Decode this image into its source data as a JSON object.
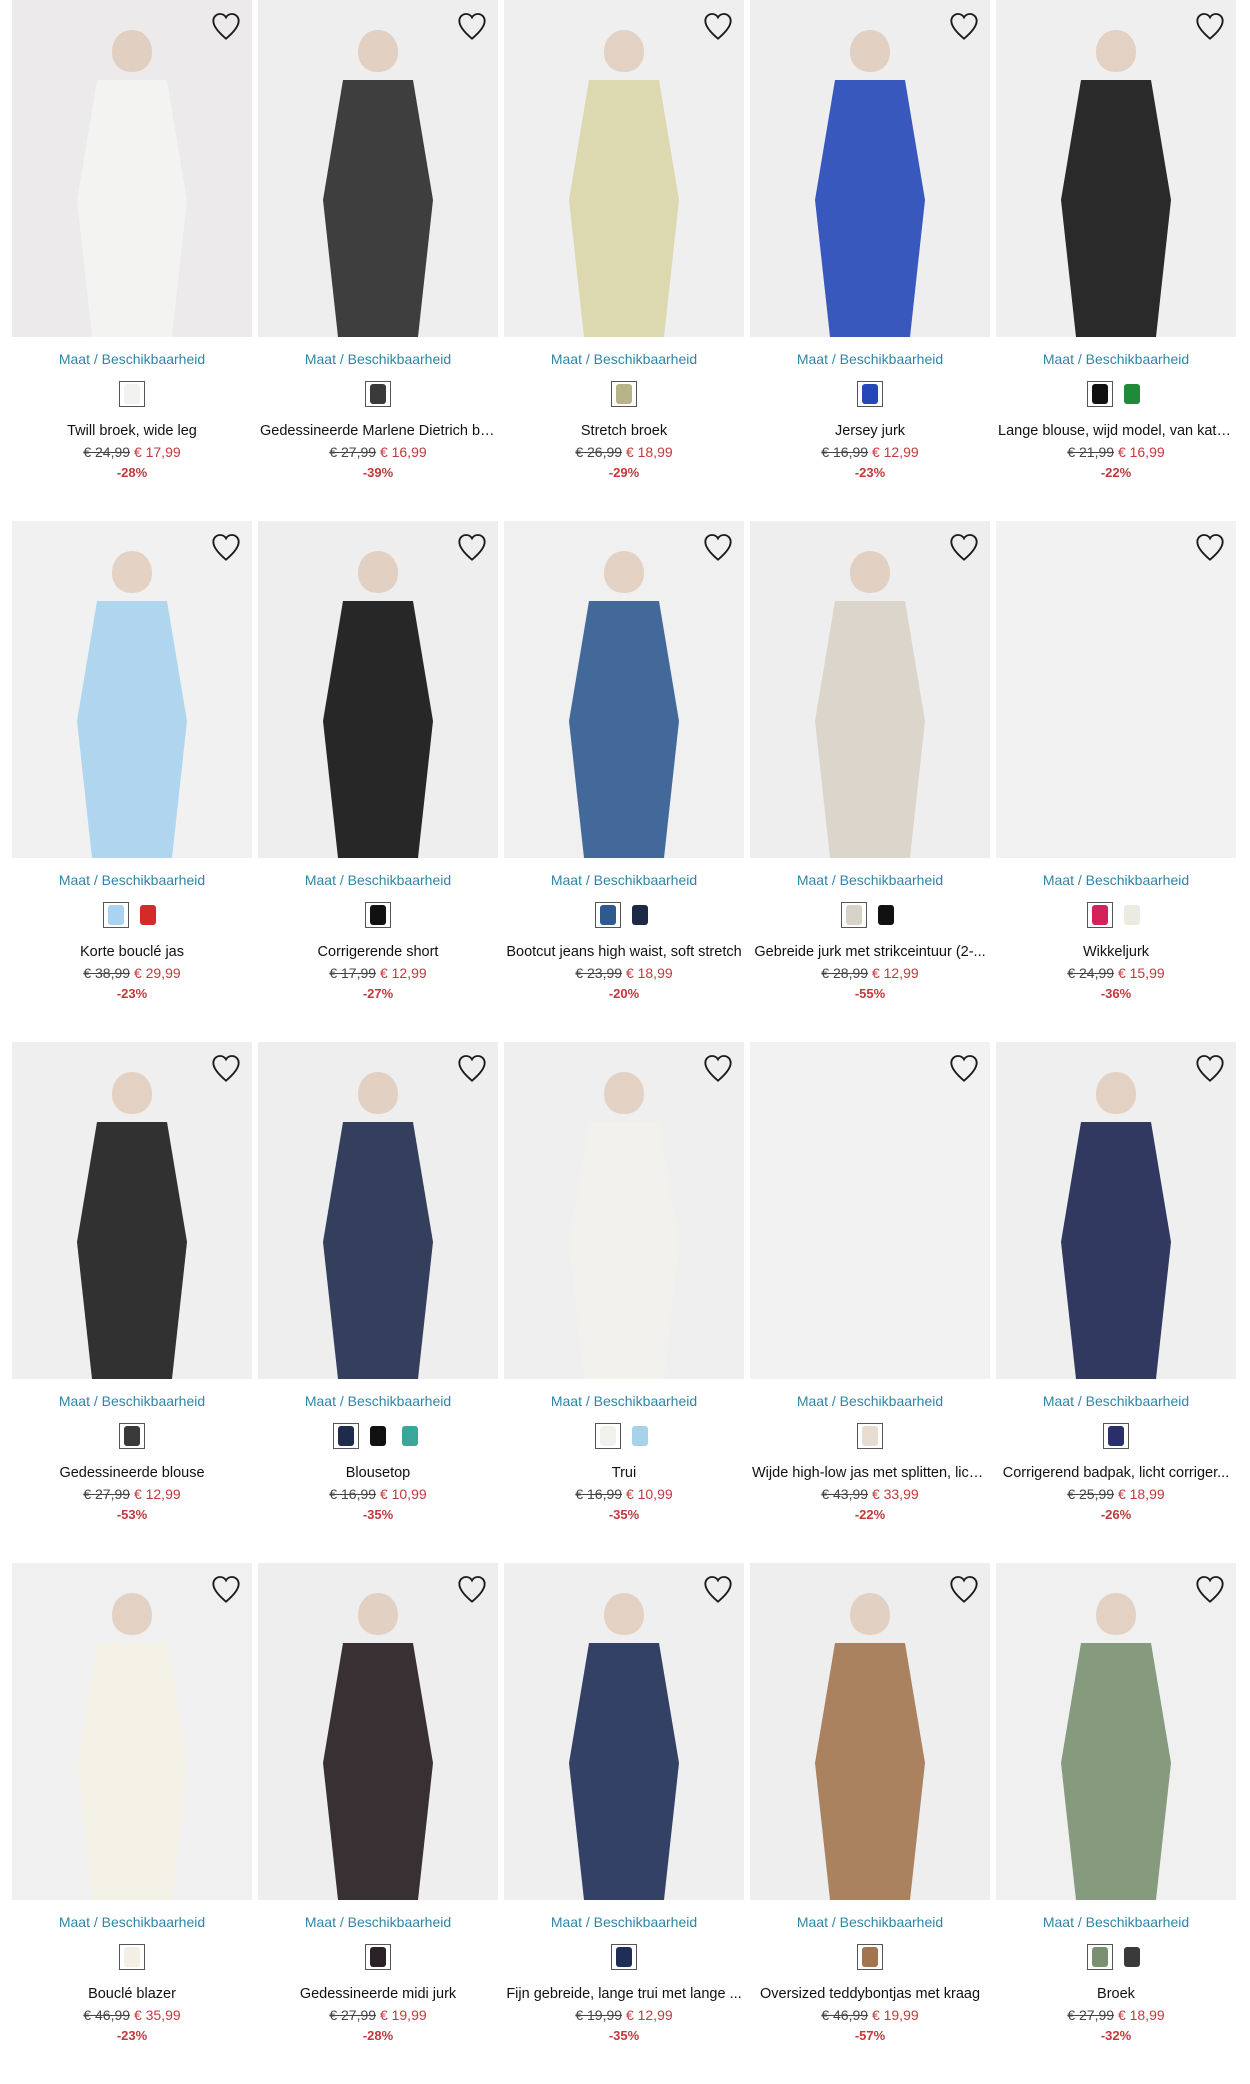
{
  "size_link_label": "Maat / Beschikbaarheid",
  "colors": {
    "link": "#2f85a6",
    "sale": "#c2393c"
  },
  "products": [
    {
      "name": "Twill broek, wide leg",
      "old_price": "€ 24,99",
      "new_price": "€ 17,99",
      "discount": "-28%",
      "image_bg": "#eceaea",
      "garment": "#f4f4f2",
      "swatches": [
        "#f2f2f0"
      ]
    },
    {
      "name": "Gedessineerde Marlene Dietrich br...",
      "old_price": "€ 27,99",
      "new_price": "€ 16,99",
      "discount": "-39%",
      "image_bg": "#eeeeee",
      "garment": "#2a2a2a",
      "swatches": [
        "#3a3a3a"
      ]
    },
    {
      "name": "Stretch broek",
      "old_price": "€ 26,99",
      "new_price": "€ 18,99",
      "discount": "-29%",
      "image_bg": "#efefef",
      "garment": "#d9d6a8",
      "swatches": [
        "#b9b38a"
      ]
    },
    {
      "name": "Jersey jurk",
      "old_price": "€ 16,99",
      "new_price": "€ 12,99",
      "discount": "-23%",
      "image_bg": "#eeeeee",
      "garment": "#2547b8",
      "swatches": [
        "#2547b8"
      ]
    },
    {
      "name": "Lange blouse, wijd model, van katoen",
      "old_price": "€ 21,99",
      "new_price": "€ 16,99",
      "discount": "-22%",
      "image_bg": "#efefef",
      "garment": "#141414",
      "swatches": [
        "#111111",
        "#1e8a3a"
      ]
    },
    {
      "name": "Korte bouclé jas",
      "old_price": "€ 38,99",
      "new_price": "€ 29,99",
      "discount": "-23%",
      "image_bg": "#f1f1f1",
      "garment": "#a9d3ee",
      "swatches": [
        "#a9d3ee",
        "#d42a2a"
      ]
    },
    {
      "name": "Corrigerende short",
      "old_price": "€ 17,99",
      "new_price": "€ 12,99",
      "discount": "-27%",
      "image_bg": "#eeeeee",
      "garment": "#111111",
      "swatches": [
        "#111111"
      ]
    },
    {
      "name": "Bootcut jeans high waist, soft stretch",
      "old_price": "€ 23,99",
      "new_price": "€ 18,99",
      "discount": "-20%",
      "image_bg": "#f0f0f0",
      "garment": "#2f5a8f",
      "swatches": [
        "#2f5a8f",
        "#1c2a45"
      ]
    },
    {
      "name": "Gebreide jurk met strikceintuur (2-...",
      "old_price": "€ 28,99",
      "new_price": "€ 12,99",
      "discount": "-55%",
      "image_bg": "#eeeeee",
      "garment": "#d8d2c8",
      "swatches": [
        "#d8d2c8",
        "#111111"
      ]
    },
    {
      "name": "Wikkeljurk",
      "old_price": "€ 24,99",
      "new_price": "€ 15,99",
      "discount": "-36%",
      "image_bg": "#f2f2f2",
      "garment": "#f2f2f2",
      "swatches": [
        "#d4215a",
        "#ecebe2"
      ]
    },
    {
      "name": "Gedessineerde blouse",
      "old_price": "€ 27,99",
      "new_price": "€ 12,99",
      "discount": "-53%",
      "image_bg": "#efefef",
      "garment": "#1c1c1c",
      "swatches": [
        "#3a3a3a"
      ]
    },
    {
      "name": "Blousetop",
      "old_price": "€ 16,99",
      "new_price": "€ 10,99",
      "discount": "-35%",
      "image_bg": "#eeeeee",
      "garment": "#1f2b4d",
      "swatches": [
        "#1f2b4d",
        "#111111",
        "#3aa69a"
      ]
    },
    {
      "name": "Trui",
      "old_price": "€ 16,99",
      "new_price": "€ 10,99",
      "discount": "-35%",
      "image_bg": "#efefef",
      "garment": "#f3f1ec",
      "swatches": [
        "#f3f1ec",
        "#a8d2ea"
      ]
    },
    {
      "name": "Wijde high-low jas met splitten, lich...",
      "old_price": "€ 43,99",
      "new_price": "€ 33,99",
      "discount": "-22%",
      "image_bg": "#f2f2f2",
      "garment": "#f2f2f2",
      "swatches": [
        "#e6ddd0"
      ]
    },
    {
      "name": "Corrigerend badpak, licht corriger...",
      "old_price": "€ 25,99",
      "new_price": "€ 18,99",
      "discount": "-26%",
      "image_bg": "#efefef",
      "garment": "#1d2550",
      "swatches": [
        "#2a2f6b"
      ]
    },
    {
      "name": "Bouclé blazer",
      "old_price": "€ 46,99",
      "new_price": "€ 35,99",
      "discount": "-23%",
      "image_bg": "#f0f0f0",
      "garment": "#f3efe4",
      "swatches": [
        "#f3efe4"
      ]
    },
    {
      "name": "Gedessineerde midi jurk",
      "old_price": "€ 27,99",
      "new_price": "€ 19,99",
      "discount": "-28%",
      "image_bg": "#eeeeee",
      "garment": "#231b1d",
      "swatches": [
        "#2a2226"
      ]
    },
    {
      "name": "Fijn gebreide, lange trui met lange ...",
      "old_price": "€ 19,99",
      "new_price": "€ 12,99",
      "discount": "-35%",
      "image_bg": "#efefef",
      "garment": "#1f2e57",
      "swatches": [
        "#1f2e57"
      ]
    },
    {
      "name": "Oversized teddybontjas met kraag",
      "old_price": "€ 46,99",
      "new_price": "€ 19,99",
      "discount": "-57%",
      "image_bg": "#eeeeee",
      "garment": "#a27550",
      "swatches": [
        "#a27550"
      ]
    },
    {
      "name": "Broek",
      "old_price": "€ 27,99",
      "new_price": "€ 18,99",
      "discount": "-32%",
      "image_bg": "#f0f0f0",
      "garment": "#7a9070",
      "swatches": [
        "#7a9070",
        "#3a3a3a"
      ]
    }
  ]
}
